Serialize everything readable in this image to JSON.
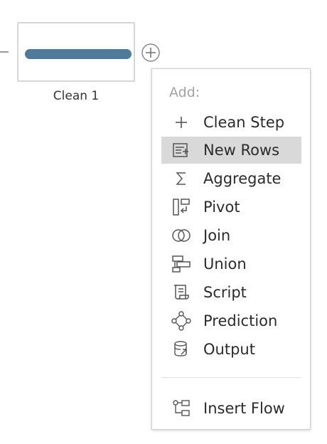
{
  "flow": {
    "step_name": "Clean 1",
    "step_color": "#4e7a9c"
  },
  "add_menu": {
    "header": "Add:",
    "items": [
      {
        "label": "Clean Step",
        "icon": "plus-icon",
        "highlighted": false
      },
      {
        "label": "New Rows",
        "icon": "new-rows-icon",
        "highlighted": true
      },
      {
        "label": "Aggregate",
        "icon": "sigma-icon",
        "highlighted": false
      },
      {
        "label": "Pivot",
        "icon": "pivot-icon",
        "highlighted": false
      },
      {
        "label": "Join",
        "icon": "join-icon",
        "highlighted": false
      },
      {
        "label": "Union",
        "icon": "union-icon",
        "highlighted": false
      },
      {
        "label": "Script",
        "icon": "script-icon",
        "highlighted": false
      },
      {
        "label": "Prediction",
        "icon": "prediction-icon",
        "highlighted": false
      },
      {
        "label": "Output",
        "icon": "output-icon",
        "highlighted": false
      }
    ],
    "insert_flow": {
      "label": "Insert Flow",
      "icon": "insert-flow-icon"
    }
  },
  "colors": {
    "highlight": "#d9d9d9",
    "icon_stroke": "#555555"
  }
}
